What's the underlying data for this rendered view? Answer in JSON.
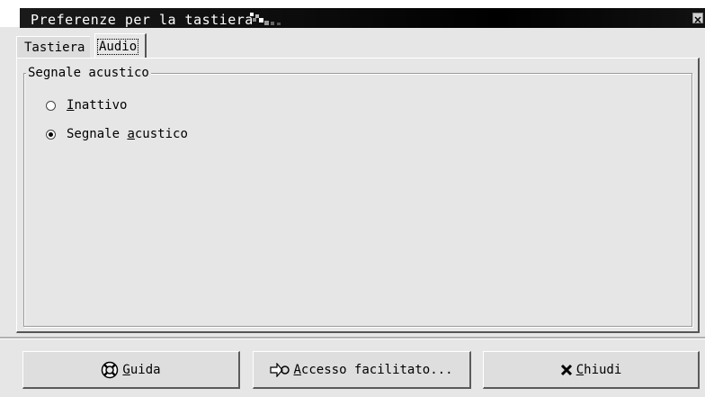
{
  "window": {
    "title": "Preferenze per la tastiera"
  },
  "tabs": [
    {
      "label": "Tastiera",
      "selected": false
    },
    {
      "label": "Audio",
      "selected": true
    }
  ],
  "audio": {
    "group_title": "Segnale acustico",
    "options": [
      {
        "mnemonic": "I",
        "rest": "nattivo",
        "checked": false
      },
      {
        "prefix": "Segnale ",
        "mnemonic": "a",
        "rest": "custico",
        "checked": true
      }
    ]
  },
  "buttons": {
    "help": {
      "mnemonic": "G",
      "rest": "uida",
      "icon": "lifebuoy-icon"
    },
    "accessibility": {
      "mnemonic": "A",
      "rest": "ccesso facilitato...",
      "icon": "accessibility-arrow-icon"
    },
    "close": {
      "mnemonic": "C",
      "rest": "hiudi",
      "icon": "close-x-icon"
    }
  }
}
